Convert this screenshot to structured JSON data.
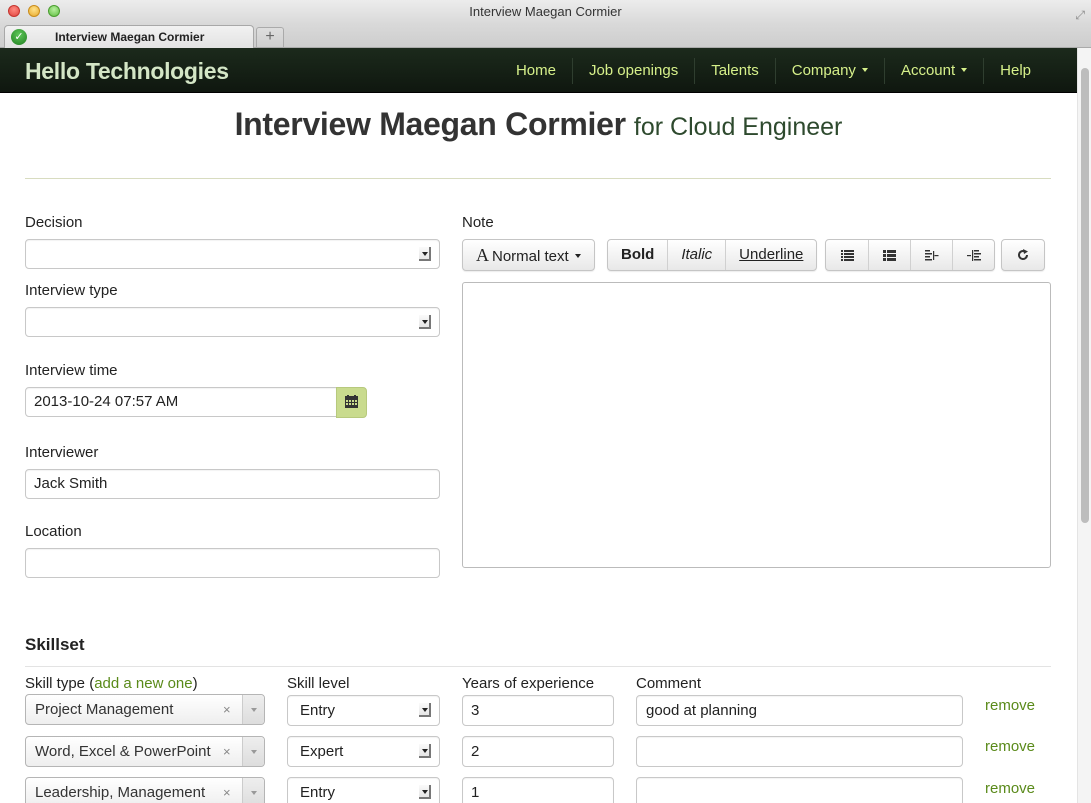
{
  "window": {
    "title": "Interview Maegan Cormier",
    "tab_title": "Interview Maegan Cormier",
    "new_tab_label": "+"
  },
  "navbar": {
    "brand": "Hello Technologies",
    "items": [
      {
        "label": "Home",
        "dropdown": false
      },
      {
        "label": "Job openings",
        "dropdown": false
      },
      {
        "label": "Talents",
        "dropdown": false
      },
      {
        "label": "Company",
        "dropdown": true
      },
      {
        "label": "Account",
        "dropdown": true
      },
      {
        "label": "Help",
        "dropdown": false
      }
    ]
  },
  "page": {
    "title": "Interview Maegan Cormier",
    "subtitle": "for Cloud Engineer"
  },
  "form": {
    "decision": {
      "label": "Decision",
      "value": ""
    },
    "interview_type": {
      "label": "Interview type",
      "value": ""
    },
    "interview_time": {
      "label": "Interview time",
      "value": "2013-10-24 07:57 AM"
    },
    "interviewer": {
      "label": "Interviewer",
      "value": "Jack Smith"
    },
    "location": {
      "label": "Location",
      "value": ""
    },
    "note": {
      "label": "Note",
      "value": "",
      "toolbar": {
        "text_style": "Normal text",
        "bold": "Bold",
        "italic": "Italic",
        "underline": "Underline",
        "icons": [
          "unordered-list-icon",
          "ordered-list-icon",
          "outdent-icon",
          "indent-icon"
        ],
        "redo_icon": "refresh-icon"
      }
    }
  },
  "skillset": {
    "title": "Skillset",
    "headers": {
      "skill_type_prefix": "Skill type (",
      "add_link": "add a new one",
      "skill_type_suffix": ")",
      "skill_level": "Skill level",
      "years": "Years of experience",
      "comment": "Comment"
    },
    "rows": [
      {
        "skill_type": "Project Management",
        "skill_level": "Entry",
        "years": "3",
        "comment": "good at planning",
        "remove": "remove"
      },
      {
        "skill_type": "Word, Excel & PowerPoint",
        "skill_level": "Expert",
        "years": "2",
        "comment": "",
        "remove": "remove"
      },
      {
        "skill_type": "Leadership, Management",
        "skill_level": "Entry",
        "years": "1",
        "comment": "",
        "remove": "remove"
      }
    ],
    "clear_glyph": "×"
  },
  "colors": {
    "navbar_bg": "#142014",
    "nav_link": "#d6f08a",
    "brand": "#d4e6c6",
    "accent_link": "#5a8a1a",
    "calendar_btn": "#c9db8e"
  }
}
